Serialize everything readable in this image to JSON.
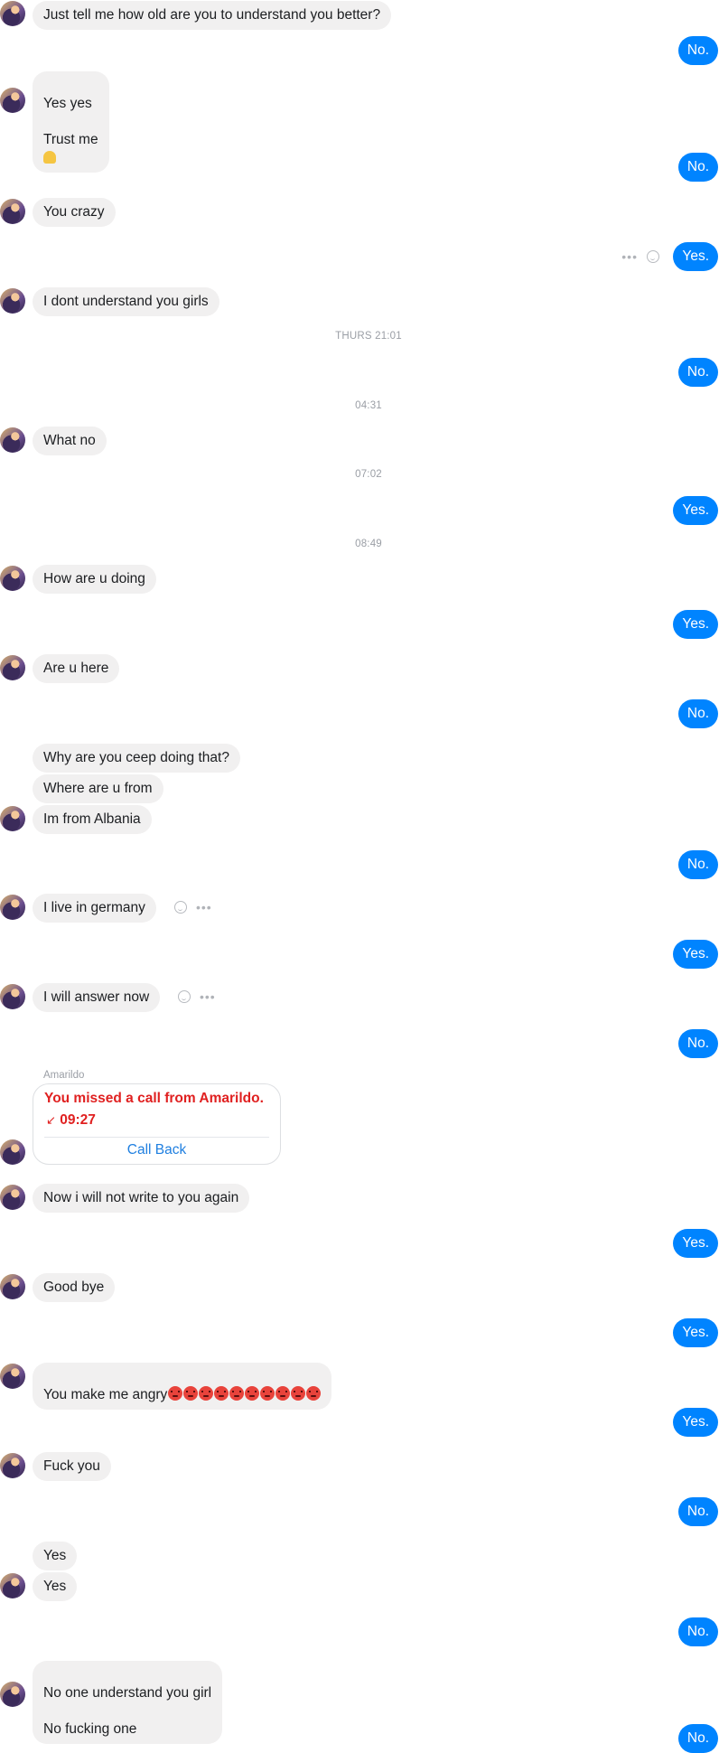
{
  "contact": {
    "name": "Amarildo"
  },
  "messages": {
    "m1": "Just tell me how old are you to understand you better?",
    "m2": "No.",
    "m3_line1": "Yes yes",
    "m3_line2": "Trust me",
    "m4": "No.",
    "m5": "You crazy",
    "m6": "Yes.",
    "m7": "I dont understand you girls",
    "ts1": "THURS 21:01",
    "m8": "No.",
    "ts2": "04:31",
    "m9": "What no",
    "ts3": "07:02",
    "m10": "Yes.",
    "ts4": "08:49",
    "m11": "How are u doing",
    "m12": "Yes.",
    "m13": "Are u here",
    "m14": "No.",
    "m15": "Why are you ceep doing that?",
    "m16": "Where are u from",
    "m17": "Im from Albania",
    "m18": "No.",
    "m19": "I live in germany",
    "m20": "Yes.",
    "m21": "I will answer now",
    "m22": "No.",
    "m24": "Now i will not write to you again",
    "m25": "Yes.",
    "m26": "Good bye",
    "m27": "Yes.",
    "m28": "You make me angry",
    "m29": "Yes.",
    "m30": "Fuck you",
    "m31": "No.",
    "m32": "Yes",
    "m33": "Yes",
    "m34": "No.",
    "m35_line1": "No one understand you girl",
    "m35_line2": "No fucking one",
    "m36": "No."
  },
  "missed_call": {
    "title": "You missed a call from Amarildo.",
    "time": "09:27",
    "callback_label": "Call Back"
  },
  "icons": {
    "more": "more-dots-icon",
    "react": "smiley-reaction-icon",
    "angry": "angry-face-emoji",
    "bell": "bell-emoji"
  },
  "colors": {
    "outgoing_bubble": "#0084ff",
    "incoming_bubble": "#f1f0f0",
    "missed_call_red": "#e02020",
    "callback_blue": "#1f7fe0"
  }
}
